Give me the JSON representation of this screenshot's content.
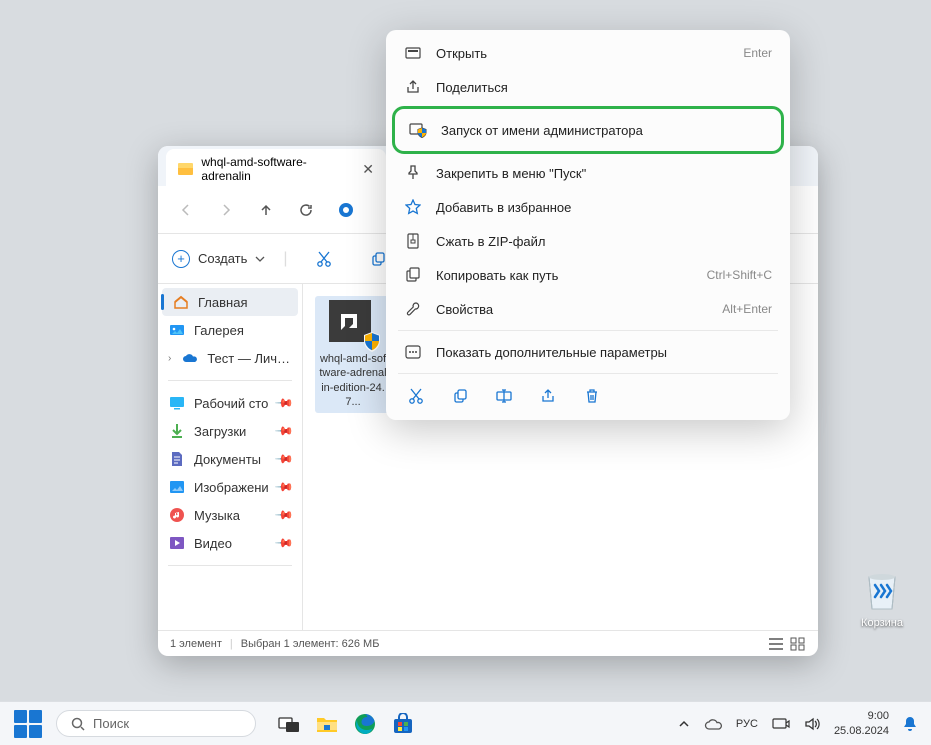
{
  "tab": {
    "title": "whql-amd-software-adrenalin"
  },
  "cmdbar": {
    "new": "Создать"
  },
  "sidebar": {
    "home": "Главная",
    "gallery": "Галерея",
    "personal": "Тест — Личное",
    "desktop": "Рабочий сто",
    "downloads": "Загрузки",
    "documents": "Документы",
    "pictures": "Изображени",
    "music": "Музыка",
    "videos": "Видео"
  },
  "file": {
    "name": "whql-amd-software-adrenalin-edition-24.7..."
  },
  "status": {
    "count": "1 элемент",
    "selected": "Выбран 1 элемент: 626 МБ"
  },
  "ctx": {
    "open": {
      "label": "Открыть",
      "shortcut": "Enter"
    },
    "share": {
      "label": "Поделиться"
    },
    "runadmin": {
      "label": "Запуск от имени администратора"
    },
    "pinstart": {
      "label": "Закрепить в меню \"Пуск\""
    },
    "favorite": {
      "label": "Добавить в избранное"
    },
    "zip": {
      "label": "Сжать в ZIP-файл"
    },
    "copypath": {
      "label": "Копировать как путь",
      "shortcut": "Ctrl+Shift+C"
    },
    "props": {
      "label": "Свойства",
      "shortcut": "Alt+Enter"
    },
    "more": {
      "label": "Показать дополнительные параметры"
    }
  },
  "recycle": {
    "label": "Корзина"
  },
  "taskbar": {
    "search": "Поиск",
    "lang": "РУС",
    "time": "9:00",
    "date": "25.08.2024"
  }
}
